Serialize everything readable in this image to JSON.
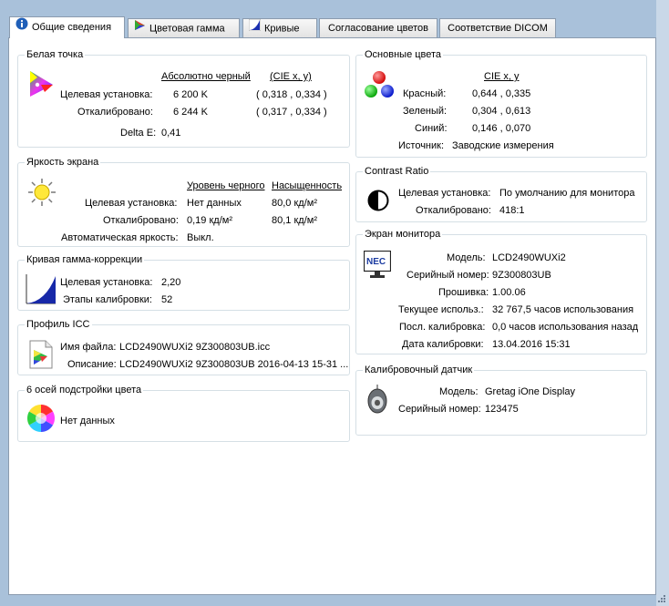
{
  "tabs": [
    {
      "label": "Общие сведения",
      "icon": "info-icon"
    },
    {
      "label": "Цветовая гамма",
      "icon": "gamut-triangle-icon"
    },
    {
      "label": "Кривые",
      "icon": "curve-icon"
    },
    {
      "label": "Согласование цветов",
      "icon": ""
    },
    {
      "label": "Соответствие DICOM",
      "icon": ""
    }
  ],
  "white_point": {
    "title": "Белая точка",
    "col_black": "Абсолютно черный",
    "col_cie": "(CIE x, y)",
    "target_label": "Целевая установка:",
    "target_temp": "6 200 K",
    "target_cie": "( 0,318 , 0,334 )",
    "cal_label": "Откалибровано:",
    "cal_temp": "6 244 K",
    "cal_cie": "( 0,317 , 0,334 )",
    "delta_label": "Delta E:",
    "delta_value": "0,41"
  },
  "brightness": {
    "title": "Яркость экрана",
    "col_black": "Уровень черного",
    "col_sat": "Насыщенность",
    "target_label": "Целевая установка:",
    "target_black": "Нет данных",
    "target_sat": "80,0 кд/м²",
    "cal_label": "Откалибровано:",
    "cal_black": "0,19 кд/м²",
    "cal_sat": "80,1 кд/м²",
    "auto_label": "Автоматическая яркость:",
    "auto_value": "Выкл."
  },
  "gamma": {
    "title": "Кривая гамма-коррекции",
    "target_label": "Целевая установка:",
    "target_value": "2,20",
    "steps_label": "Этапы калибровки:",
    "steps_value": "52"
  },
  "icc": {
    "title": "Профиль ICC",
    "file_label": "Имя файла:",
    "file_value": "LCD2490WUXi2 9Z300803UB.icc",
    "desc_label": "Описание:",
    "desc_value": "LCD2490WUXi2 9Z300803UB 2016-04-13 15-31 ..."
  },
  "six_axis": {
    "title": "6 осей подстройки цвета",
    "value": "Нет данных"
  },
  "primaries": {
    "title": "Основные цвета",
    "col_cie": "CIE x, y",
    "red_label": "Красный:",
    "red_value": "0,644 , 0,335",
    "green_label": "Зеленый:",
    "green_value": "0,304 , 0,613",
    "blue_label": "Синий:",
    "blue_value": "0,146 , 0,070",
    "source_label": "Источник:",
    "source_value": "Заводские измерения"
  },
  "contrast": {
    "title": "Contrast Ratio",
    "target_label": "Целевая установка:",
    "target_value": "По умолчанию для монитора",
    "cal_label": "Откалибровано:",
    "cal_value": "418:1"
  },
  "monitor": {
    "title": "Экран монитора",
    "brand": "NEC",
    "model_label": "Модель:",
    "model_value": "LCD2490WUXi2",
    "serial_label": "Серийный номер:",
    "serial_value": "9Z300803UB",
    "fw_label": "Прошивка:",
    "fw_value": "1.00.06",
    "usage_label": "Текущее использ.:",
    "usage_value": "32 767,5 часов использования",
    "lastcal_label": "Посл. калибровка:",
    "lastcal_value": "0,0 часов использования назад",
    "caldate_label": "Дата калибровки:",
    "caldate_value": "13.04.2016 15:31"
  },
  "sensor": {
    "title": "Калибровочный датчик",
    "model_label": "Модель:",
    "model_value": "Gretag iOne Display",
    "serial_label": "Серийный номер:",
    "serial_value": "123475"
  }
}
